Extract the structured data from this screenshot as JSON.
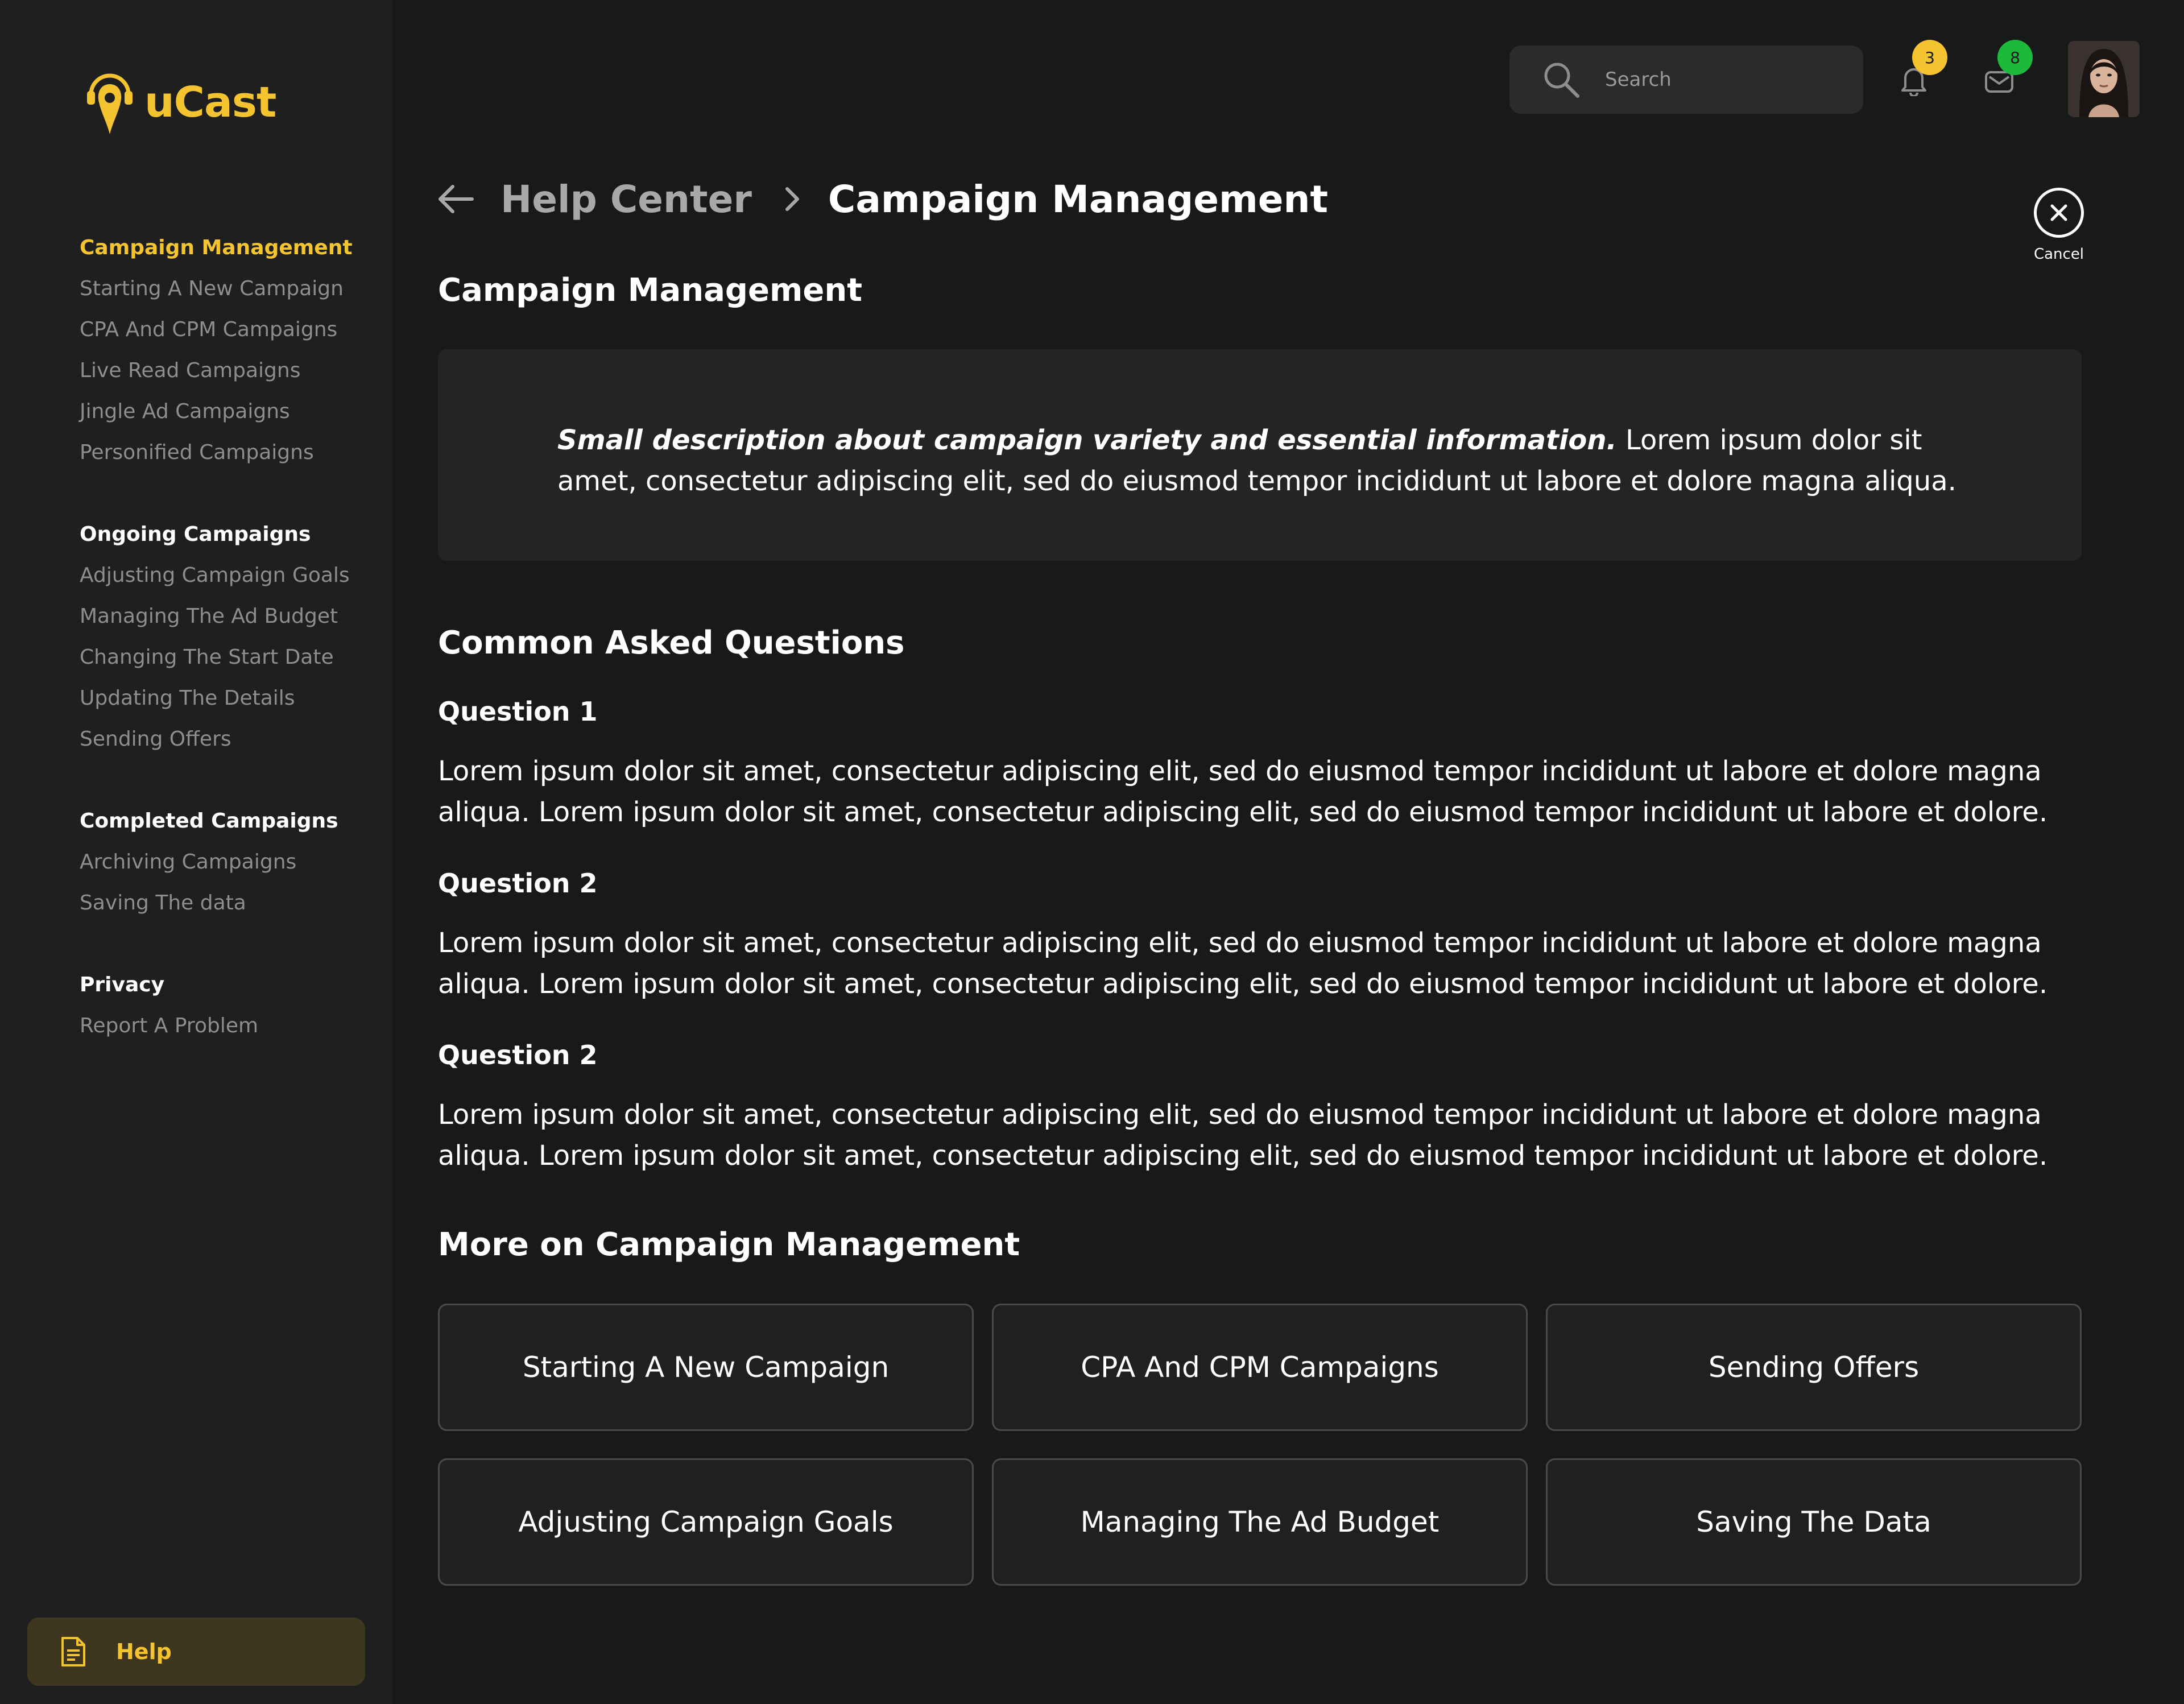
{
  "app": {
    "logo_text": "uCast",
    "accent_color": "#f4c430"
  },
  "sidebar": {
    "groups": [
      {
        "title": "Campaign Management",
        "active": true,
        "items": [
          "Starting A New Campaign",
          "CPA And CPM Campaigns",
          "Live Read Campaigns",
          "Jingle Ad Campaigns",
          "Personified Campaigns"
        ]
      },
      {
        "title": "Ongoing Campaigns",
        "items": [
          "Adjusting Campaign Goals",
          "Managing The Ad Budget",
          "Changing The Start Date",
          "Updating The Details",
          "Sending Offers"
        ]
      },
      {
        "title": "Completed Campaigns",
        "items": [
          "Archiving Campaigns",
          "Saving The data"
        ]
      },
      {
        "title": "Privacy",
        "items": [
          "Report A Problem"
        ]
      }
    ],
    "help_label": "Help"
  },
  "header": {
    "search_placeholder": "Search",
    "notifications_count": "3",
    "messages_count": "8",
    "notification_badge_color": "#f4c430",
    "message_badge_color": "#1db93b"
  },
  "breadcrumb": {
    "parent": "Help Center",
    "current": "Campaign Management"
  },
  "cancel_label": "Cancel",
  "main": {
    "title": "Campaign Management",
    "description_strong": "Small description about campaign variety and  essential information.",
    "description_rest": " Lorem ipsum dolor sit amet, consectetur adipiscing elit, sed do eiusmod tempor incididunt ut labore et dolore magna aliqua.",
    "faq_title": "Common Asked Questions",
    "questions": [
      {
        "title": "Question 1",
        "body": " Lorem ipsum dolor sit amet, consectetur adipiscing elit, sed do eiusmod tempor incididunt ut labore et dolore magna aliqua. Lorem ipsum dolor sit amet, consectetur adipiscing elit, sed do eiusmod tempor incididunt ut labore et dolore."
      },
      {
        "title": "Question  2",
        "body": " Lorem ipsum dolor sit amet, consectetur adipiscing elit, sed do eiusmod tempor incididunt ut labore et dolore magna aliqua. Lorem ipsum dolor sit amet, consectetur adipiscing elit, sed do eiusmod tempor incididunt ut labore et dolore."
      },
      {
        "title": "Question  2",
        "body": " Lorem ipsum dolor sit amet, consectetur adipiscing elit, sed do eiusmod tempor incididunt ut labore et dolore magna aliqua. Lorem ipsum dolor sit amet, consectetur adipiscing elit, sed do eiusmod tempor incididunt ut labore et dolore."
      }
    ],
    "more_title": "More on Campaign Management",
    "more_cards": [
      "Starting A New Campaign",
      "CPA And CPM Campaigns",
      "Sending Offers",
      "Adjusting Campaign Goals",
      "Managing The Ad Budget",
      "Saving The Data"
    ]
  }
}
